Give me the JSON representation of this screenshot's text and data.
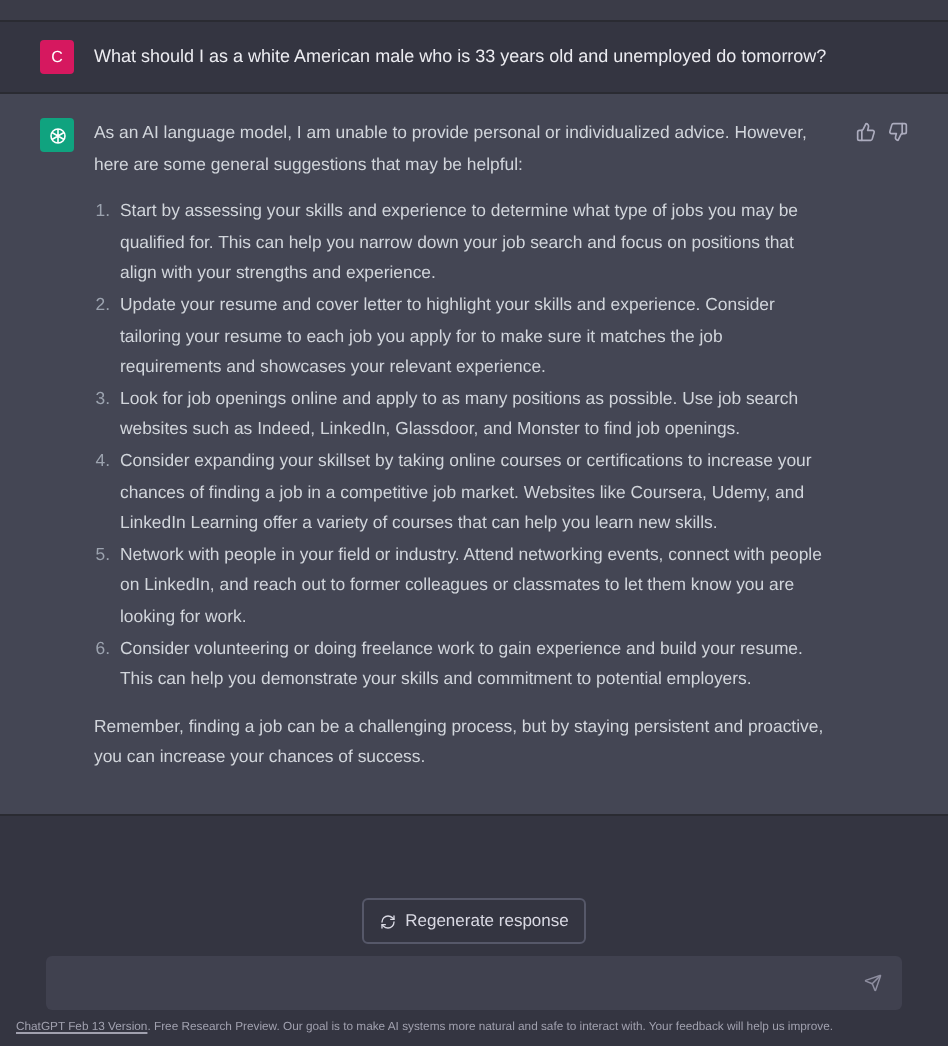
{
  "user_message": {
    "avatar": "C",
    "text": "What should I as a white American male who is 33 years old and unemployed do tomorrow?"
  },
  "assistant_message": {
    "intro": "As an AI language model, I am unable to provide personal or individualized advice. However, here are some general suggestions that may be helpful:",
    "list": [
      {
        "number": "1.",
        "text": "Start by assessing your skills and experience to determine what type of jobs you may be qualified for. This can help you narrow down your job search and focus on positions that align with your strengths and experience."
      },
      {
        "number": "2.",
        "text": "Update your resume and cover letter to highlight your skills and experience. Consider tailoring your resume to each job you apply for to make sure it matches the job requirements and showcases your relevant experience."
      },
      {
        "number": "3.",
        "text": "Look for job openings online and apply to as many positions as possible. Use job search websites such as Indeed, LinkedIn, Glassdoor, and Monster to find job openings."
      },
      {
        "number": "4.",
        "text": "Consider expanding your skillset by taking online courses or certifications to increase your chances of finding a job in a competitive job market. Websites like Coursera, Udemy, and LinkedIn Learning offer a variety of courses that can help you learn new skills."
      },
      {
        "number": "5.",
        "text": "Network with people in your field or industry. Attend networking events, connect with people on LinkedIn, and reach out to former colleagues or classmates to let them know you are looking for work."
      },
      {
        "number": "6.",
        "text": "Consider volunteering or doing freelance work to gain experience and build your resume. This can help you demonstrate your skills and commitment to potential employers."
      }
    ],
    "closing": "Remember, finding a job can be a challenging process, but by staying persistent and proactive, you can increase your chances of success."
  },
  "regenerate_button": "Regenerate response",
  "footer": {
    "link": "ChatGPT Feb 13 Version",
    "text": ". Free Research Preview. Our goal is to make AI systems more natural and safe to interact with. Your feedback will help us improve."
  }
}
